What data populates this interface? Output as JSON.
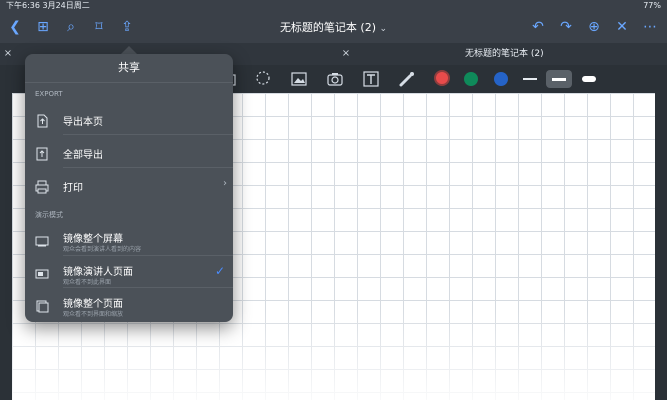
{
  "status": {
    "left": "下午6:36   3月24日周二",
    "right": "77%"
  },
  "navbar": {
    "title": "无标题的笔记本 (2)"
  },
  "tabs": {
    "active": "无标题的笔记本 (2)"
  },
  "toolbar": {
    "colors": [
      "#e84b4b",
      "#0f8a5a",
      "#2563c7"
    ]
  },
  "popover": {
    "title": "共享",
    "export_section": "EXPORT",
    "export_items": [
      {
        "label": "导出本页"
      },
      {
        "label": "全部导出"
      },
      {
        "label": "打印"
      }
    ],
    "present_section": "演示模式",
    "present_items": [
      {
        "label": "镜像整个屏幕",
        "sub": "观众会看到演讲人看到的内容"
      },
      {
        "label": "镜像演讲人页面",
        "sub": "观众看不到此界面"
      },
      {
        "label": "镜像整个页面",
        "sub": "观众看不到界面和缩放"
      }
    ]
  }
}
